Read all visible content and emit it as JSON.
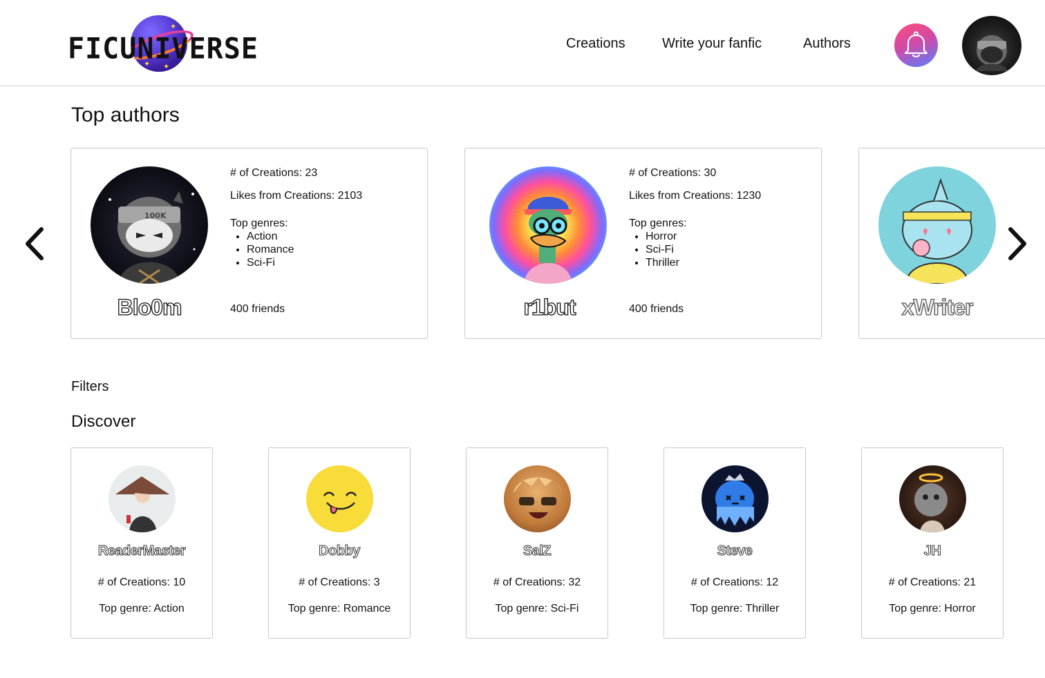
{
  "header": {
    "logo_text": "FICUNIVERSE",
    "nav": [
      {
        "label": "Creations"
      },
      {
        "label": "Write your fanfic"
      },
      {
        "label": "Authors"
      }
    ]
  },
  "top_authors": {
    "title": "Top authors",
    "cards": [
      {
        "name": "Blo0m",
        "creations": "# of Creations: 23",
        "likes": "Likes from Creations: 2103",
        "genres_label": "Top genres:",
        "genres": [
          "Action",
          "Romance",
          "Sci-Fi"
        ],
        "friends": "400 friends"
      },
      {
        "name": "r1but",
        "creations": "# of Creations: 30",
        "likes": "Likes from Creations: 1230",
        "genres_label": "Top genres:",
        "genres": [
          "Horror",
          "Sci-Fi",
          "Thriller"
        ],
        "friends": "400 friends"
      },
      {
        "name": "xWriter"
      }
    ]
  },
  "filters_label": "Filters",
  "discover": {
    "title": "Discover",
    "cards": [
      {
        "name": "ReaderMaster",
        "creations": "# of Creations: 10",
        "genre": "Top genre: Action"
      },
      {
        "name": "Dobby",
        "creations": "# of Creations: 3",
        "genre": "Top genre: Romance"
      },
      {
        "name": "SalZ",
        "creations": "# of Creations: 32",
        "genre": "Top genre: Sci-Fi"
      },
      {
        "name": "Steve",
        "creations": "# of Creations: 12",
        "genre": "Top genre: Thriller"
      },
      {
        "name": "JH",
        "creations": "# of Creations: 21",
        "genre": "Top genre: Horror"
      }
    ]
  },
  "icons": {
    "notification": "bell-icon",
    "prev": "chevron-left-icon",
    "next": "chevron-right-icon"
  },
  "colors": {
    "bell_gradient_start": "#ff4d7a",
    "bell_gradient_end": "#5a7dff",
    "card_border": "#c8c8c8"
  }
}
